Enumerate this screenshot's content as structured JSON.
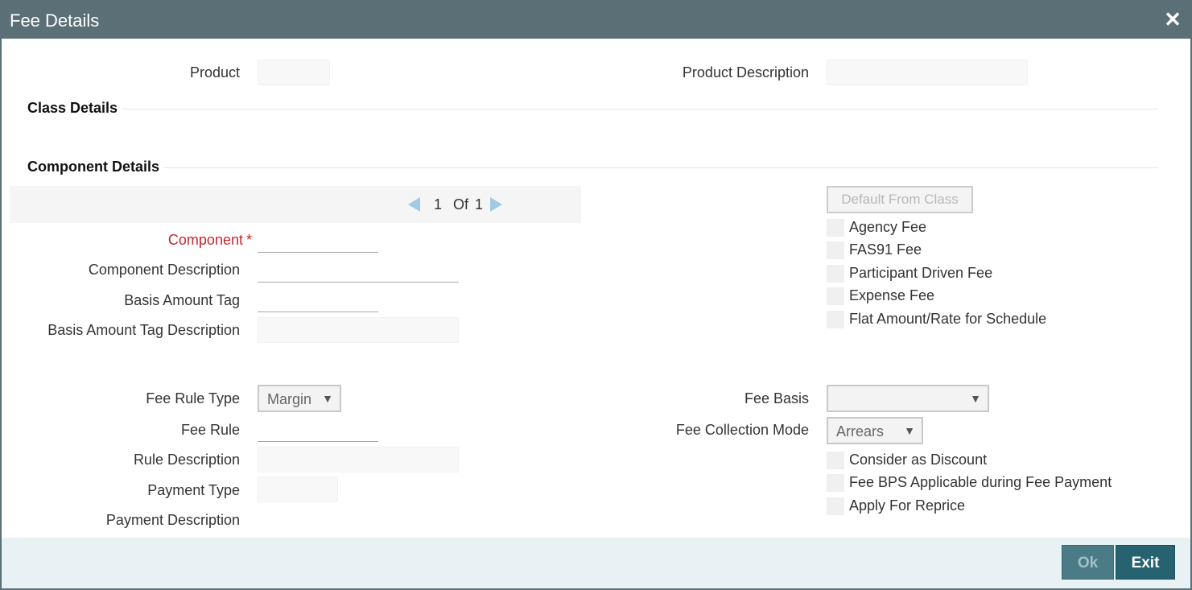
{
  "window": {
    "title": "Fee Details",
    "close_glyph": "✕"
  },
  "header": {
    "product_label": "Product",
    "product_value": "",
    "product_description_label": "Product Description",
    "product_description_value": ""
  },
  "sections": {
    "class_details": "Class Details",
    "component_details": "Component Details"
  },
  "pager": {
    "current": "1",
    "of_label": "Of",
    "total": "1"
  },
  "component": {
    "component_label": "Component",
    "required_marker": "*",
    "component_value": "",
    "component_description_label": "Component Description",
    "component_description_value": "",
    "basis_amount_tag_label": "Basis Amount Tag",
    "basis_amount_tag_value": "",
    "basis_amount_tag_description_label": "Basis Amount Tag Description",
    "basis_amount_tag_description_value": ""
  },
  "right_panel": {
    "default_from_class_label": "Default From Class",
    "checkboxes": [
      {
        "label": "Agency Fee",
        "checked": false
      },
      {
        "label": "FAS91 Fee",
        "checked": false
      },
      {
        "label": "Participant Driven Fee",
        "checked": false
      },
      {
        "label": "Expense Fee",
        "checked": false
      },
      {
        "label": "Flat Amount/Rate for Schedule",
        "checked": false
      }
    ]
  },
  "fee": {
    "fee_rule_type_label": "Fee Rule Type",
    "fee_rule_type_value": "Margin",
    "fee_rule_label": "Fee Rule",
    "fee_rule_value": "",
    "rule_description_label": "Rule Description",
    "rule_description_value": "",
    "payment_type_label": "Payment Type",
    "payment_type_value": "",
    "payment_description_label": "Payment Description",
    "fee_basis_label": "Fee Basis",
    "fee_basis_value": "",
    "fee_collection_mode_label": "Fee Collection Mode",
    "fee_collection_mode_value": "Arrears",
    "checkboxes": [
      {
        "label": "Consider as Discount",
        "checked": false
      },
      {
        "label": "Fee BPS Applicable during Fee Payment",
        "checked": false
      },
      {
        "label": "Apply For Reprice",
        "checked": false
      }
    ]
  },
  "footer": {
    "ok_label": "Ok",
    "exit_label": "Exit"
  },
  "colors": {
    "titlebar": "#5a7076",
    "required": "#c0282d",
    "footer_bg": "#e8f1f4",
    "ok_button": "#4b7b86",
    "exit_button": "#26626f",
    "pager_arrow": "#9fcbe6"
  }
}
